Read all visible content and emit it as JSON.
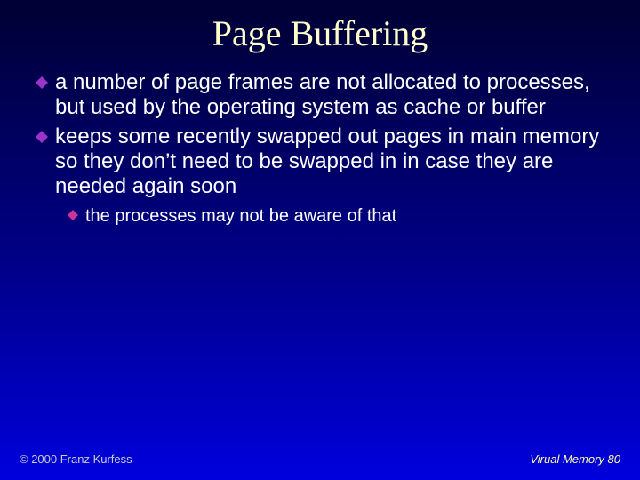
{
  "slide": {
    "title": "Page Buffering",
    "bullets": {
      "b1": "a number of page frames are not allocated to processes, but used by the operating system as cache or buffer",
      "b2": "keeps some recently swapped out pages in main memory so they don’t need to be swapped in in case they are needed again soon",
      "b2_1": "the processes may not be aware of that"
    },
    "footer": {
      "copyright": "© 2000 Franz Kurfess",
      "pageinfo": "Virual Memory 80"
    }
  }
}
